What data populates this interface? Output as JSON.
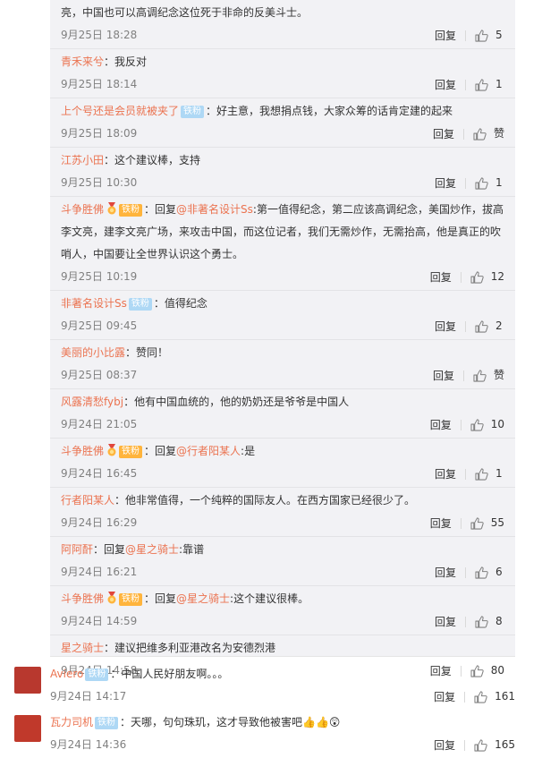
{
  "reply_label": "回复",
  "sub_comments": [
    {
      "author": "",
      "badge": "",
      "medal": false,
      "text": "亮，中国也可以高调纪念这位死于非命的反美斗士。",
      "time": "9月25日 18:28",
      "likes": "5"
    },
    {
      "author": "青禾来兮",
      "badge": "",
      "medal": false,
      "text": "：我反对",
      "time": "9月25日 18:14",
      "likes": "1"
    },
    {
      "author": "上个号还是会员就被夹了",
      "badge": "铁粉",
      "medal": false,
      "text": "：好主意，我想捐点钱，大家众筹的话肯定建的起来",
      "time": "9月25日 18:09",
      "likes": "赞"
    },
    {
      "author": "江苏小田",
      "badge": "",
      "medal": false,
      "text": "：这个建议棒，支持",
      "time": "9月25日 10:30",
      "likes": "1"
    },
    {
      "author": "斗争胜佛",
      "badge": "铁粉",
      "medal": true,
      "reply_prefix": "：回复",
      "reply_to": "@非著名设计Ss",
      "text": ":第一值得纪念，第二应该高调纪念，美国炒作，拔高李文亮，建李文亮广场，来攻击中国，而这位记者，我们无需炒作，无需抬高，他是真正的吹哨人，中国要让全世界认识这个勇士。",
      "time": "9月25日 10:19",
      "likes": "12"
    },
    {
      "author": "非著名设计Ss",
      "badge": "铁粉",
      "medal": false,
      "text": "：值得纪念",
      "time": "9月25日 09:45",
      "likes": "2"
    },
    {
      "author": "美丽的小比露",
      "badge": "",
      "medal": false,
      "text": "：赞同！",
      "time": "9月25日 08:37",
      "likes": "赞"
    },
    {
      "author": "风露清愁fybj",
      "badge": "",
      "medal": false,
      "text": "：他有中国血统的，他的奶奶还是爷爷是中国人",
      "time": "9月24日 21:05",
      "likes": "10"
    },
    {
      "author": "斗争胜佛",
      "badge": "铁粉",
      "medal": true,
      "reply_prefix": "：回复",
      "reply_to": "@行者阳某人",
      "text": ":是",
      "time": "9月24日 16:45",
      "likes": "1"
    },
    {
      "author": "行者阳某人",
      "badge": "",
      "medal": false,
      "text": "：他非常值得，一个纯粹的国际友人。在西方国家已经很少了。",
      "time": "9月24日 16:29",
      "likes": "55"
    },
    {
      "author": "阿阿酐",
      "badge": "",
      "medal": false,
      "reply_prefix": "：回复",
      "reply_to": "@星之骑士",
      "text": ":靠谱",
      "time": "9月24日 16:21",
      "likes": "6"
    },
    {
      "author": "斗争胜佛",
      "badge": "铁粉",
      "medal": true,
      "reply_prefix": "：回复",
      "reply_to": "@星之骑士",
      "text": ":这个建议很棒。",
      "time": "9月24日 14:59",
      "likes": "8"
    },
    {
      "author": "星之骑士",
      "badge": "",
      "medal": false,
      "text": "：建议把维多利亚港改名为安德烈港",
      "time": "9月24日 14:58",
      "likes": "80"
    }
  ],
  "main_comments": [
    {
      "author": "Aviero",
      "badge": "铁粉",
      "text": "：中国人民好朋友啊。。。",
      "time": "9月24日 14:17",
      "likes": "161",
      "avatar_color": "#b8382e"
    },
    {
      "author": "瓦力司机",
      "badge": "铁粉",
      "text": "：天哪，句句珠玑，这才导致他被害吧",
      "emoji": "👍👍😲",
      "time": "9月24日 14:36",
      "likes": "165",
      "avatar_color": "#c0392b"
    }
  ]
}
